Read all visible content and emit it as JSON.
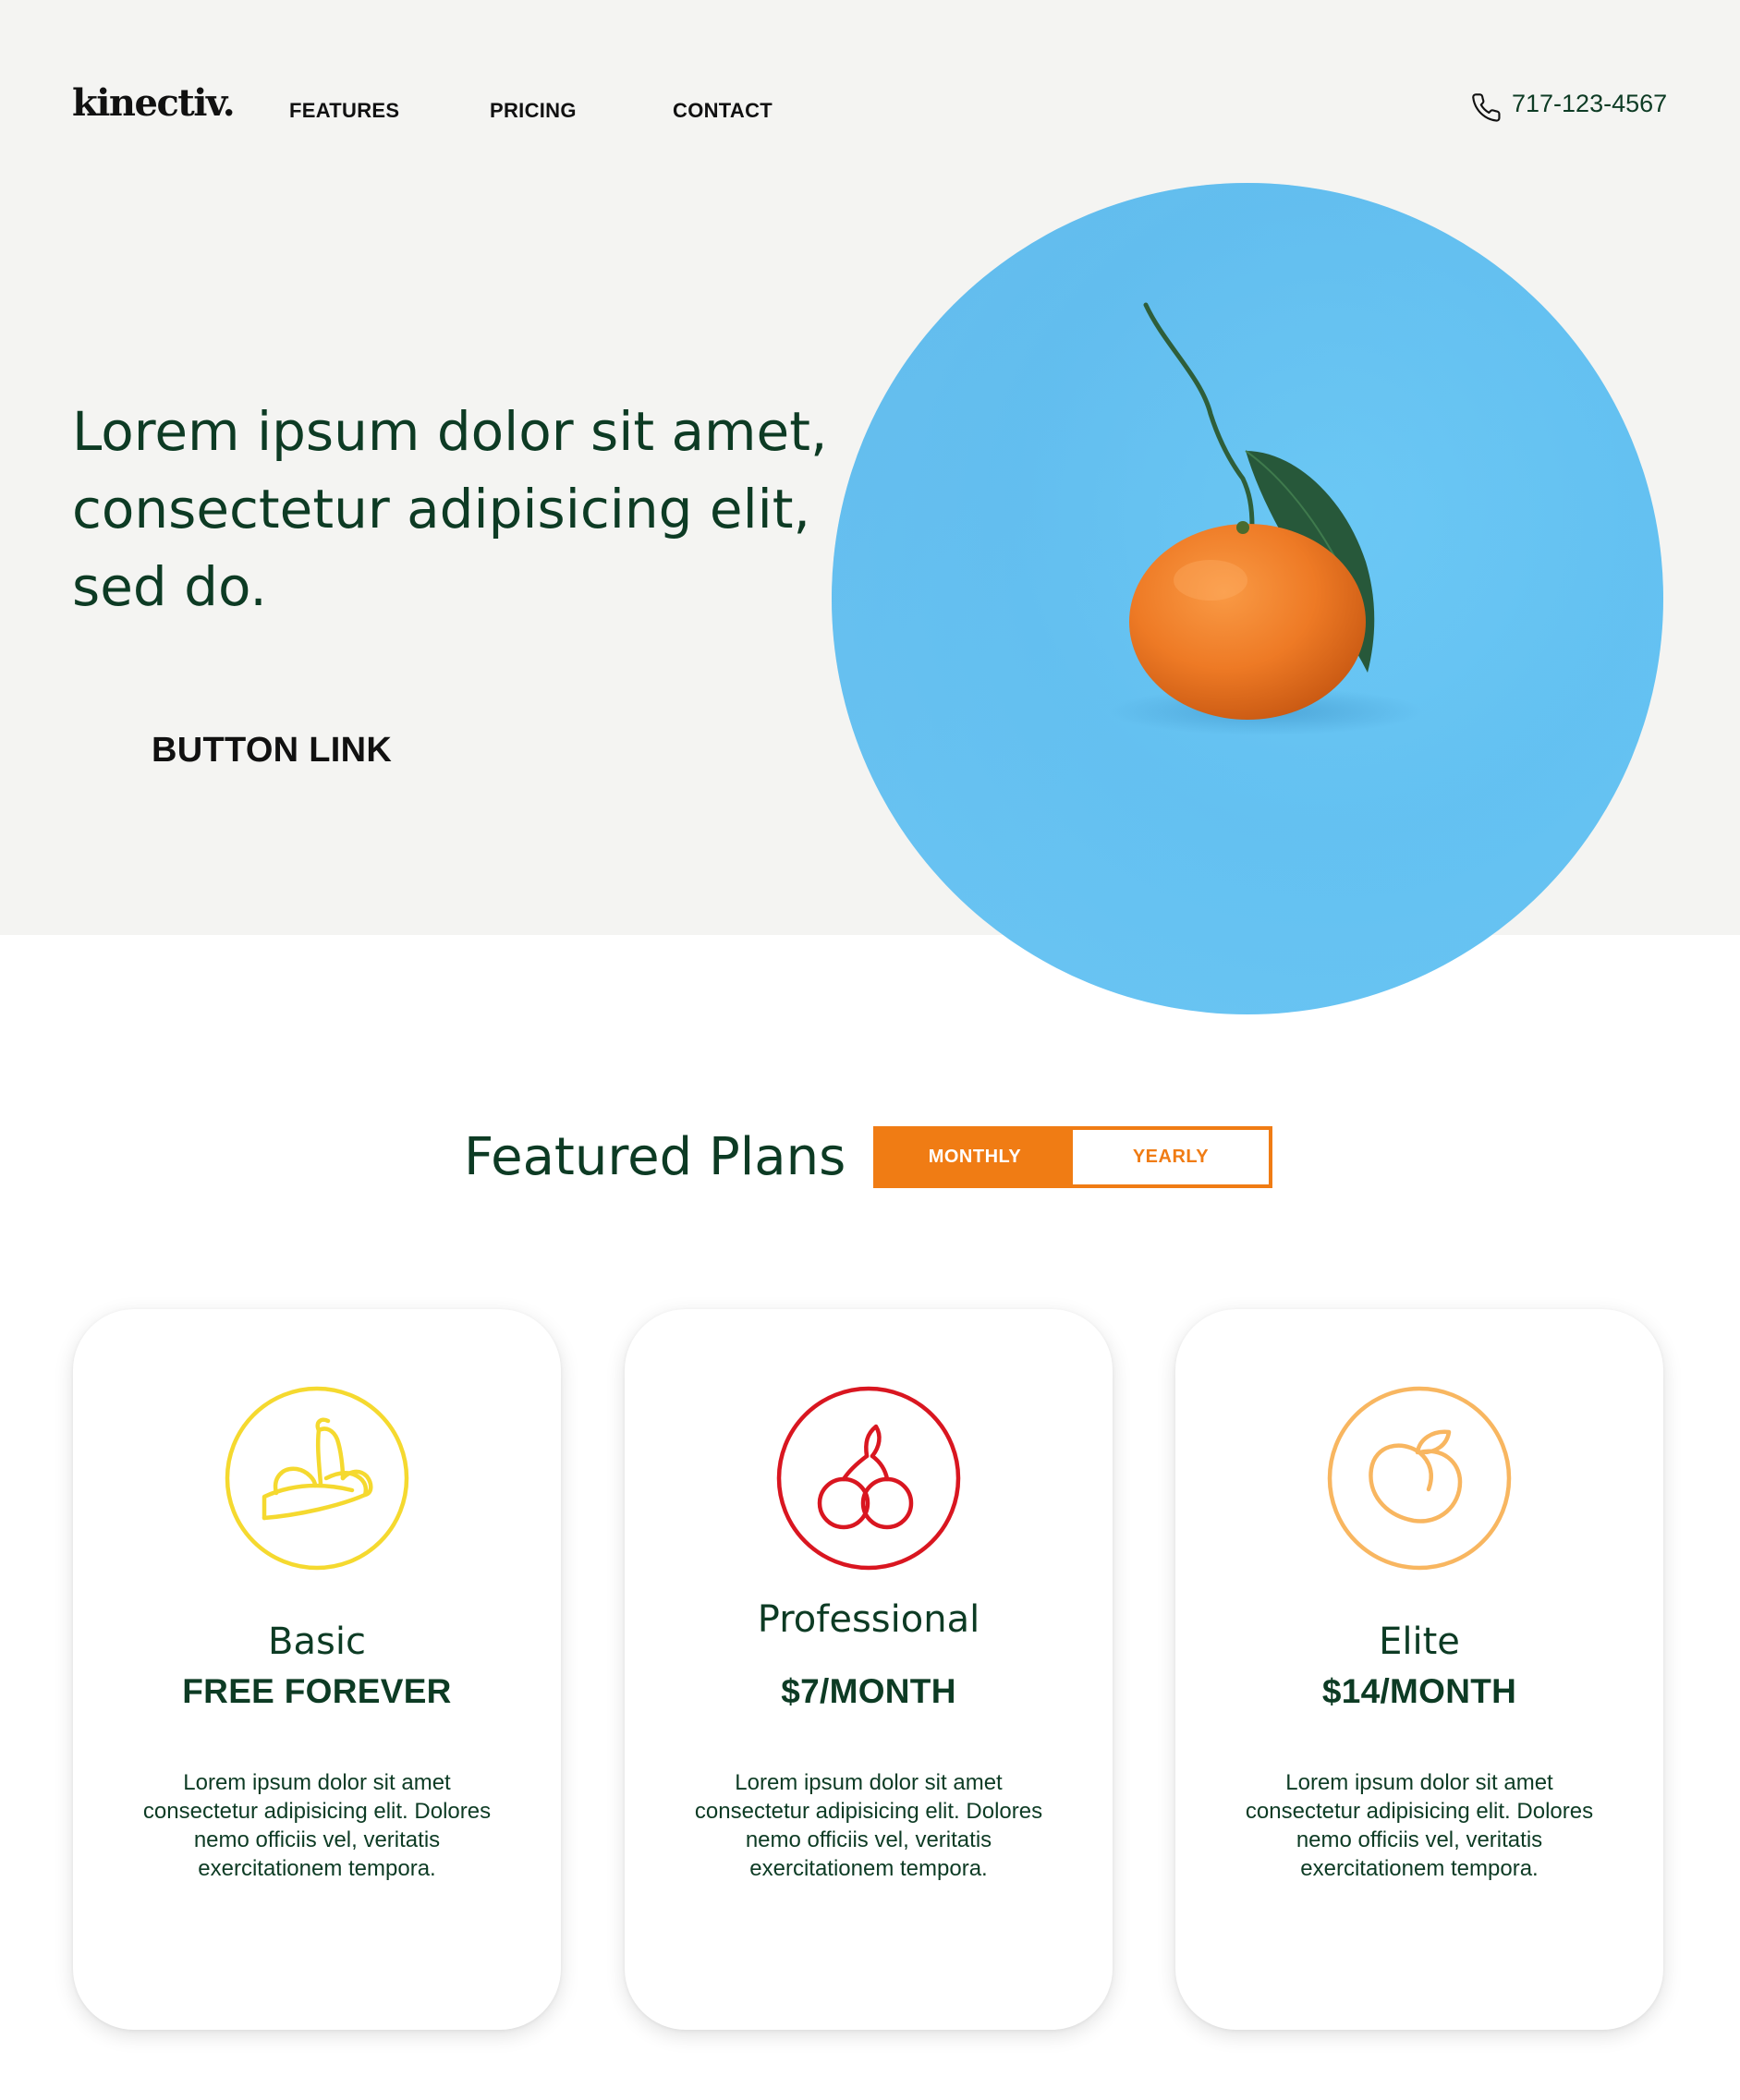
{
  "brand": {
    "logo": "kinectiv."
  },
  "nav": {
    "items": [
      {
        "label": "FEATURES"
      },
      {
        "label": "PRICING"
      },
      {
        "label": "CONTACT"
      }
    ]
  },
  "phone": {
    "icon": "phone-icon",
    "number": "717-123-4567"
  },
  "hero": {
    "headline": "Lorem ipsum dolor sit amet, consectetur adipisicing elit, sed do.",
    "button_label": "BUTTON LINK",
    "image": "orange-on-blue-circle"
  },
  "plans": {
    "title": "Featured Plans",
    "toggle": {
      "options": [
        "MONTHLY",
        "YEARLY"
      ],
      "selected": "MONTHLY"
    },
    "cards": [
      {
        "name": "Basic",
        "price": "FREE FOREVER",
        "icon": "banana-icon",
        "color": "#f5d92f",
        "description": "Lorem ipsum dolor sit amet consectetur adipisicing elit. Dolores nemo officiis vel, veritatis exercitationem tempora."
      },
      {
        "name": "Professional",
        "price": "$7/MONTH",
        "icon": "cherries-icon",
        "color": "#d91620",
        "description": "Lorem ipsum dolor sit amet consectetur adipisicing elit. Dolores nemo officiis vel, veritatis exercitationem tempora."
      },
      {
        "name": "Elite",
        "price": "$14/MONTH",
        "icon": "peach-icon",
        "color": "#f8b660",
        "description": "Lorem ipsum dolor sit amet consectetur adipisicing elit. Dolores nemo officiis vel, veritatis exercitationem tempora."
      }
    ]
  },
  "colors": {
    "primary_text": "#0d3b24",
    "accent_orange": "#f07c14",
    "hero_background": "#f4f4f2",
    "hero_circle": "#64c3f2"
  }
}
